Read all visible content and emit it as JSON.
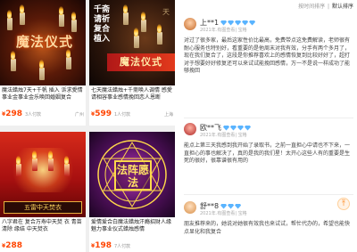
{
  "products": [
    {
      "thumb_title": "魔法仪式",
      "description": "魔法蜡烛7天+千帆 插入 诉求愛情事业金事业金乐唤回婚姻复合",
      "price_symbol": "¥",
      "price": "298",
      "paid_count": "3人付款",
      "location": "广州"
    },
    {
      "thumb_vertical": "千斋请祈复合植入",
      "thumb_banner": "魔法仪式",
      "thumb_mark": "天",
      "description": "七天魔法蜡烛+千斋唤人调情 感愛请相容事业感情挽回恋人恩断",
      "price_symbol": "¥",
      "price": "599",
      "paid_count": "1人付款",
      "location": "上海"
    },
    {
      "thumb_caption": "五雷中天焚衣",
      "description": "八字君在 复合万寿中天焚 衣 青苗 清除 缘结 中天焚衣",
      "price_symbol": "¥",
      "price": "288",
      "paid_count": "",
      "location": ""
    },
    {
      "thumb_stamp": "法阵愿法",
      "description": "爱情爱合白魔法蜡烛汗瘾招财人缘魅力事业仪式蜡烛感情",
      "price_symbol": "¥",
      "price": "198",
      "paid_count": "7人付款",
      "location": ""
    }
  ],
  "sort": {
    "option_time": "按时间排序",
    "separator": "|",
    "option_default": "默认排序"
  },
  "comments": [
    {
      "username": "上**1",
      "meta": "2021年.有图查看| 宝格",
      "text": "对过了很多家，最后这家性价比最高，免费带点这免费解读，老师很有耐心服务也特别好，看重要的是他周末对我有效，分手有两个多月了，现在我们复合了，这段是你推荐喜欢上的感情恢复到比较好好了，超打对于想要好好修复还可以来试试能挽回感情，万一不是说一样成功了能够挽回"
    },
    {
      "username": "欧**飞",
      "meta": "2021年.有图查看| 宝格",
      "text": "能点上第三天我感到我开始了录取书，之前一直担心中请也不下来，一直担心的事也解决了，真的是我的我们星！太开心这些人有的重要是生死的很好，很靠谱很有用的"
    },
    {
      "username": "舒**8",
      "meta": "2021年.有图查看| 宝格",
      "text": "朋友推荐来的，她说对她很有效我也来试试，帮忙代办的，希望也能快点显化和我复合"
    }
  ],
  "colors": {
    "price": "#ff4400",
    "diamond": "#5ab4ff",
    "meta_gray": "#aaaaaa"
  }
}
